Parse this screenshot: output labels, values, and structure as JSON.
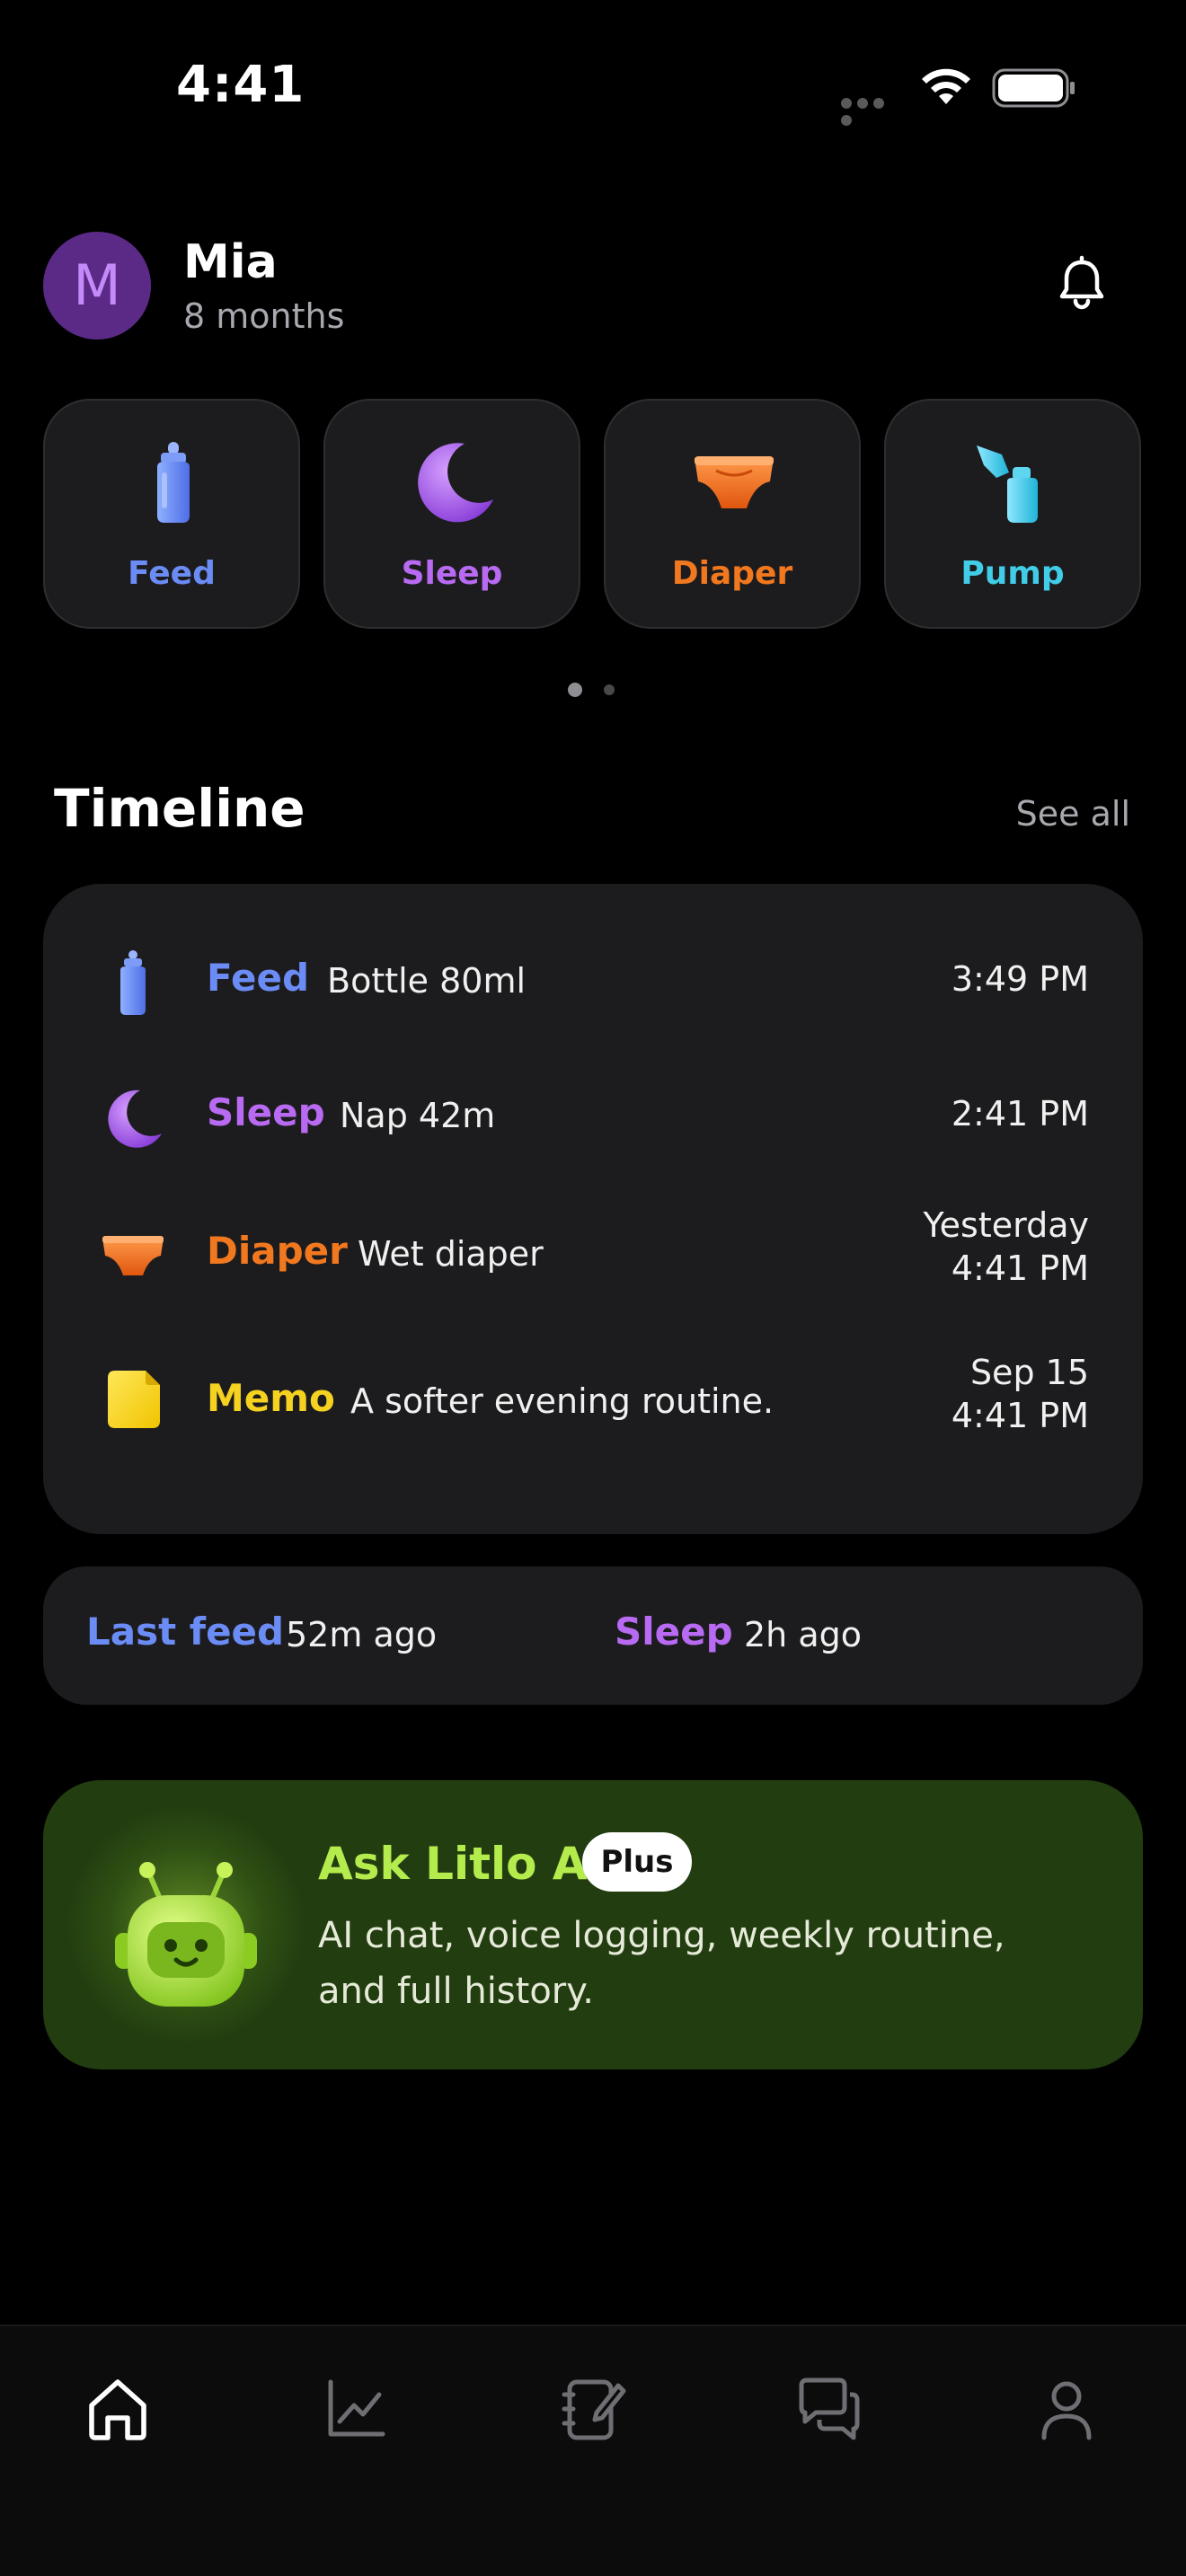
{
  "status_bar": {
    "time": "4:41"
  },
  "profile": {
    "initial": "M",
    "name": "Mia",
    "age": "8 months"
  },
  "quick_actions": [
    {
      "label": "Feed",
      "icon": "baby-bottle-icon",
      "color": "#6b8cf5"
    },
    {
      "label": "Sleep",
      "icon": "moon-icon",
      "color": "#b86af2"
    },
    {
      "label": "Diaper",
      "icon": "diaper-icon",
      "color": "#f2781f"
    },
    {
      "label": "Pump",
      "icon": "breast-pump-icon",
      "color": "#41cde8"
    }
  ],
  "pager": {
    "current_page": 1,
    "total_pages": 2
  },
  "timeline": {
    "title": "Timeline",
    "see_all": "See all",
    "entries": [
      {
        "type": "Feed",
        "detail": "Bottle 80ml",
        "time_line1": "3:49 PM",
        "time_line2": "",
        "icon": "baby-bottle-icon",
        "color": "#6b8cf5"
      },
      {
        "type": "Sleep",
        "detail": "Nap 42m",
        "time_line1": "2:41 PM",
        "time_line2": "",
        "icon": "moon-icon",
        "color": "#b86af2"
      },
      {
        "type": "Diaper",
        "detail": "Wet diaper",
        "time_line1": "Yesterday",
        "time_line2": "4:41 PM",
        "icon": "diaper-icon",
        "color": "#f2781f"
      },
      {
        "type": "Memo",
        "detail": "A softer evening routine.",
        "time_line1": "Sep 15",
        "time_line2": "4:41 PM",
        "icon": "memo-note-icon",
        "color": "#f5d220"
      }
    ]
  },
  "summary": {
    "last_feed_label": "Last feed",
    "last_feed_value": "52m ago",
    "sleep_label": "Sleep",
    "sleep_value": "2h ago"
  },
  "ai_promo": {
    "title": "Ask Litlo AI",
    "badge": "Plus",
    "description": "AI chat, voice logging, weekly routine, and full history.",
    "accent": "#b5ec4d"
  },
  "tab_bar": {
    "tabs": [
      {
        "icon": "home-icon",
        "active": true
      },
      {
        "icon": "chart-icon",
        "active": false
      },
      {
        "icon": "journal-icon",
        "active": false
      },
      {
        "icon": "chat-icon",
        "active": false
      },
      {
        "icon": "profile-icon",
        "active": false
      }
    ]
  }
}
